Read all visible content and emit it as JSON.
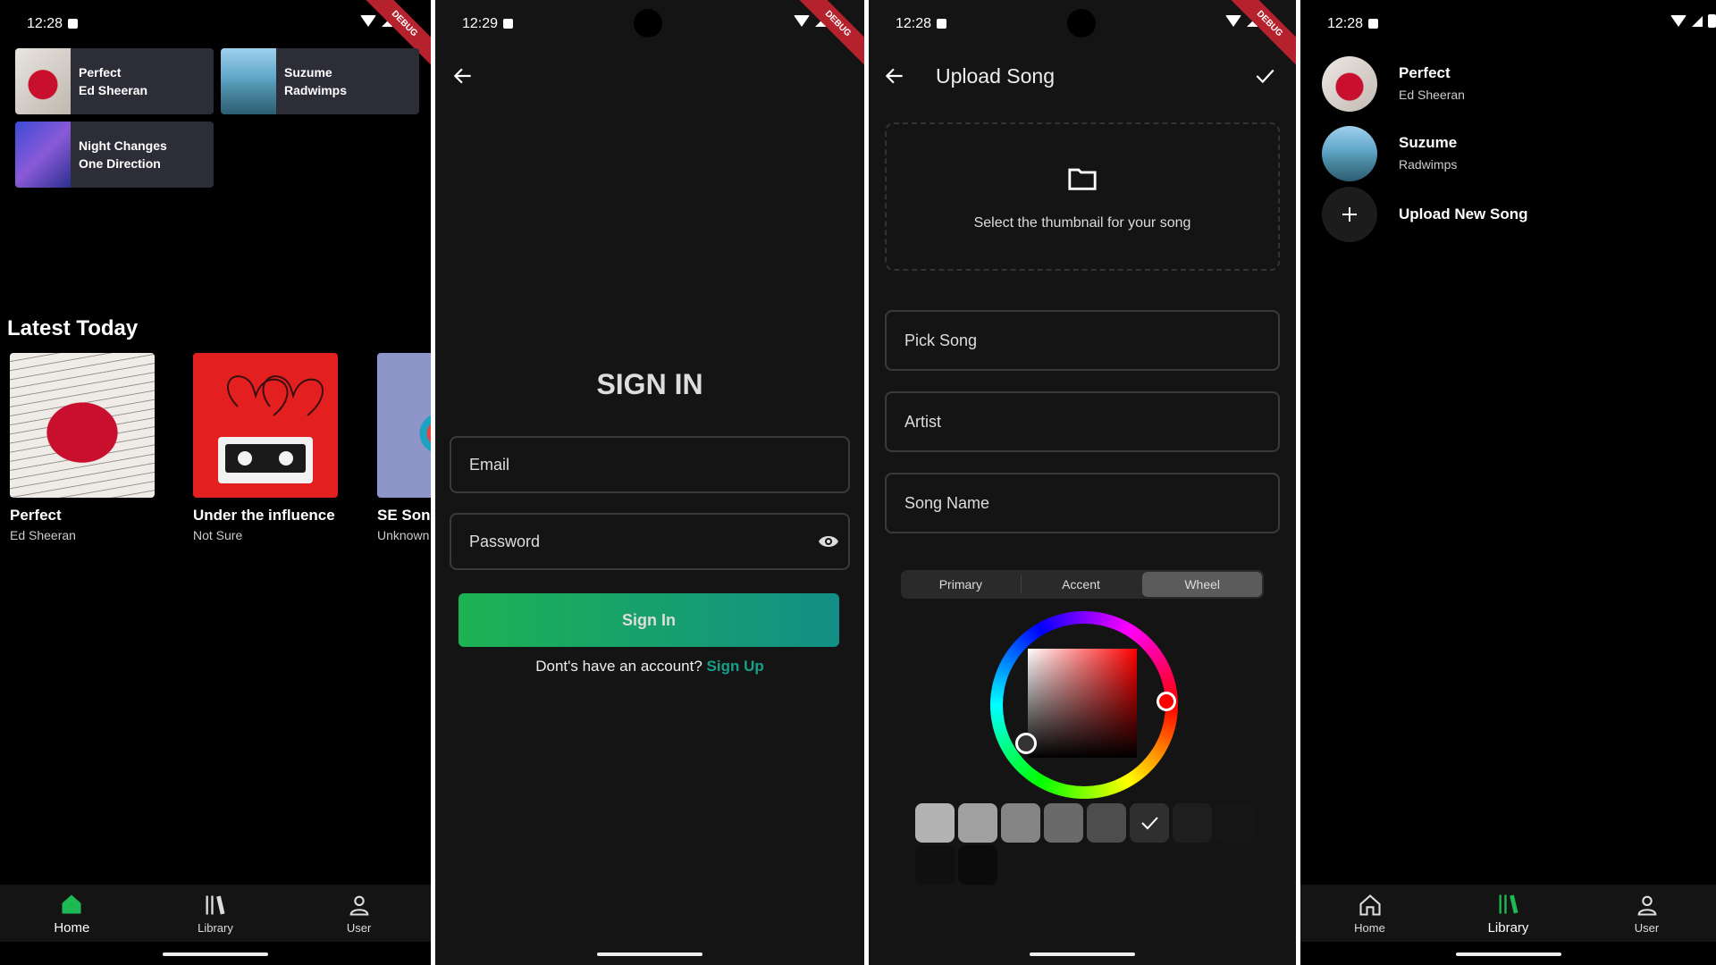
{
  "home": {
    "status_time": "12:28",
    "debug_label": "DEBUG",
    "recent": [
      {
        "title": "Perfect",
        "artist": "Ed Sheeran"
      },
      {
        "title": "Suzume",
        "artist": "Radwimps"
      },
      {
        "title": "Night Changes",
        "artist": "One Direction"
      }
    ],
    "latest_title": "Latest Today",
    "latest": [
      {
        "title": "Perfect",
        "artist": "Ed Sheeran"
      },
      {
        "title": "Under the influence",
        "artist": "Not Sure"
      },
      {
        "title": "SE Song",
        "artist": "Unknown"
      }
    ],
    "nav": [
      {
        "label": "Home"
      },
      {
        "label": "Library"
      },
      {
        "label": "User"
      }
    ]
  },
  "signin": {
    "status_time": "12:29",
    "title": "SIGN IN",
    "email_placeholder": "Email",
    "password_placeholder": "Password",
    "button_label": "Sign In",
    "no_account_text": "Dont's have an account?",
    "signup_link": "Sign Up"
  },
  "upload": {
    "status_time": "12:28",
    "title": "Upload Song",
    "thumbnail_prompt": "Select the thumbnail for your song",
    "pick_song_label": "Pick Song",
    "artist_label": "Artist",
    "song_name_label": "Song Name",
    "picker_tabs": [
      "Primary",
      "Accent",
      "Wheel"
    ],
    "selected_tab": "Wheel",
    "swatches": [
      "#b3b3b3",
      "#a0a0a0",
      "#858585",
      "#6a6a6a",
      "#4d4d4d",
      "#2f2f2f",
      "#1e1e1e",
      "#141414",
      "#101010",
      "#0b0b0b"
    ],
    "selected_color": "#ff0000"
  },
  "library": {
    "status_time": "12:28",
    "songs": [
      {
        "title": "Perfect",
        "artist": "Ed Sheeran"
      },
      {
        "title": "Suzume",
        "artist": "Radwimps"
      }
    ],
    "upload_new_label": "Upload New Song",
    "nav": [
      {
        "label": "Home"
      },
      {
        "label": "Library"
      },
      {
        "label": "User"
      }
    ]
  },
  "colors": {
    "accent": "#1db954",
    "link": "#15a08a",
    "field_border": "#3a3a3a"
  }
}
